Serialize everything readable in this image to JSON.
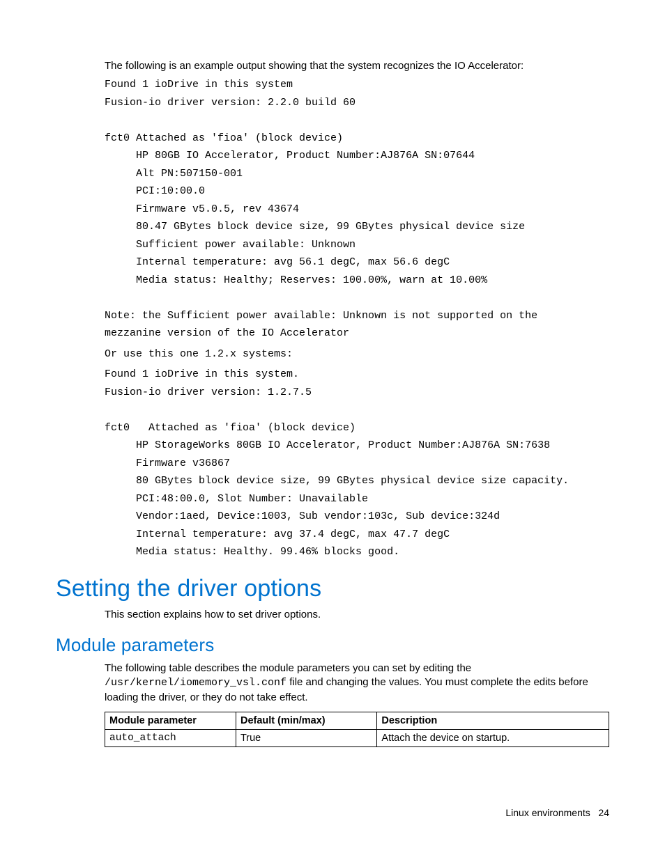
{
  "intro": "The following is an example output showing that the system recognizes the IO Accelerator:",
  "block1": "Found 1 ioDrive in this system\nFusion-io driver version: 2.2.0 build 60\n\nfct0 Attached as 'fioa' (block device)\n     HP 80GB IO Accelerator, Product Number:AJ876A SN:07644\n     Alt PN:507150-001\n     PCI:10:00.0\n     Firmware v5.0.5, rev 43674\n     80.47 GBytes block device size, 99 GBytes physical device size\n     Sufficient power available: Unknown\n     Internal temperature: avg 56.1 degC, max 56.6 degC\n     Media status: Healthy; Reserves: 100.00%, warn at 10.00%\n\nNote: the Sufficient power available: Unknown is not supported on the\nmezzanine version of the IO Accelerator",
  "or_line": "Or use this one 1.2.x systems:",
  "block2": "Found 1 ioDrive in this system.\nFusion-io driver version: 1.2.7.5\n\nfct0   Attached as 'fioa' (block device)\n     HP StorageWorks 80GB IO Accelerator, Product Number:AJ876A SN:7638\n     Firmware v36867\n     80 GBytes block device size, 99 GBytes physical device size capacity.\n     PCI:48:00.0, Slot Number: Unavailable\n     Vendor:1aed, Device:1003, Sub vendor:103c, Sub device:324d\n     Internal temperature: avg 37.4 degC, max 47.7 degC\n     Media status: Healthy. 99.46% blocks good.",
  "h1": "Setting the driver options",
  "h1_body": "This section explains how to set driver options.",
  "h2": "Module parameters",
  "h2_body_pre": "The following table describes the module parameters you can set by editing the ",
  "h2_body_path": "/usr/kernel/iomemory_vsl.conf",
  "h2_body_post": " file and changing the values. You must complete the edits before loading the driver, or they do not take effect.",
  "table": {
    "headers": [
      "Module parameter",
      "Default (min/max)",
      "Description"
    ],
    "rows": [
      {
        "param": "auto_attach",
        "default": "True",
        "desc": "Attach the device on startup."
      }
    ]
  },
  "footer": {
    "section": "Linux environments",
    "page": "24"
  }
}
